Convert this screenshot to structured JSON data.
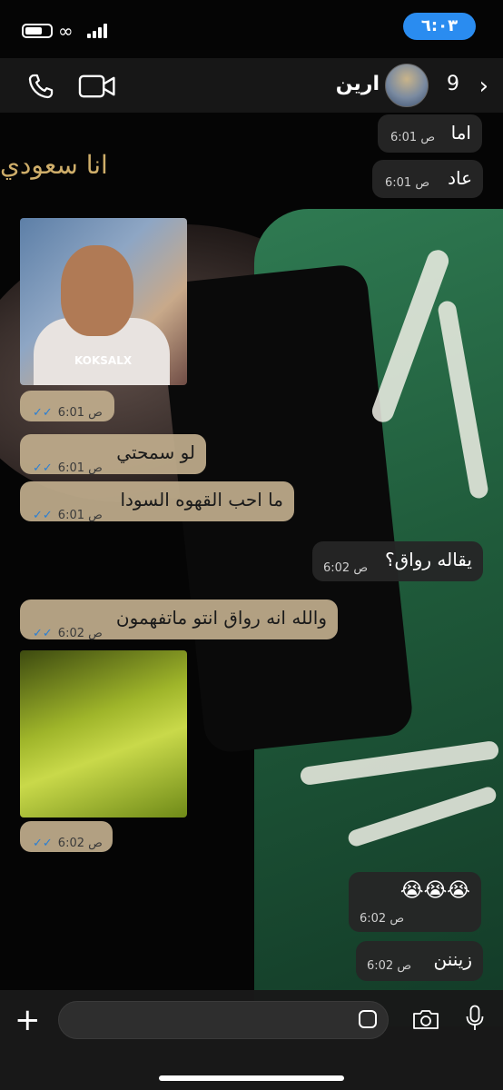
{
  "status_bar": {
    "time": "٦:٠٣"
  },
  "header": {
    "contact_name": "ارين",
    "unread_count": "9"
  },
  "messages": [
    {
      "id": "m1",
      "direction": "incoming-dark",
      "text": "اما",
      "time": "6:01 ص"
    },
    {
      "id": "m2",
      "direction": "incoming-dark",
      "text": "عاد",
      "time": "6:01 ص"
    },
    {
      "id": "m3",
      "direction": "sent",
      "type": "image",
      "image_caption": "KOKSALX",
      "time": "6:01 ص"
    },
    {
      "id": "m4",
      "direction": "sent",
      "text": "لو سمحتي",
      "time": "6:01 ص"
    },
    {
      "id": "m5",
      "direction": "sent",
      "text": "ما احب القهوه السودا",
      "time": "6:01 ص"
    },
    {
      "id": "m6",
      "direction": "incoming-dark",
      "text": "يقاله رواق؟",
      "time": "6:02 ص"
    },
    {
      "id": "m7",
      "direction": "sent",
      "text": "والله انه رواق انتو ماتفهمون",
      "time": "6:02 ص"
    },
    {
      "id": "m8",
      "direction": "sent",
      "type": "image",
      "time": "6:02 ص"
    },
    {
      "id": "m9",
      "direction": "incoming-dark",
      "text": "😭😭😭",
      "time": "6:02 ص"
    },
    {
      "id": "m10",
      "direction": "incoming-dark",
      "text": "زيننن",
      "time": "6:02 ص"
    }
  ],
  "wallpaper_text": "انا سعودي",
  "composer": {
    "placeholder": ""
  },
  "colors": {
    "time_pill": "#2a8cf0",
    "sent_bubble": "#bfac8c",
    "received_bubble": "#262626",
    "read_check": "#2a7fd4"
  }
}
